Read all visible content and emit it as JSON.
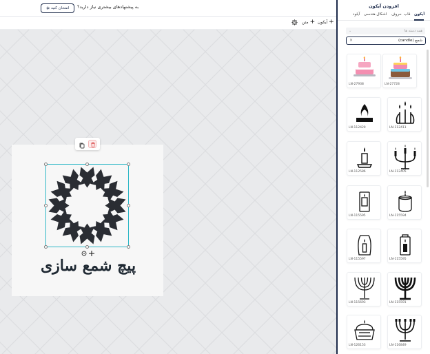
{
  "banner": {
    "message": "به پیشنهادهای بیشتری نیاز دارید؟",
    "try_button": "امتحان کنید"
  },
  "toolbar": {
    "add_icon": "آیکون",
    "add_text": "متن"
  },
  "canvas": {
    "caption": "پیچ شمع سازی"
  },
  "panel": {
    "title": "افزودن آیکون",
    "tabs": [
      "آیکون",
      "قاب",
      "حروف",
      "اشکال هندسی",
      "آیلود"
    ],
    "category_placeholder": "همه دسته ها",
    "search_value": "شمع (candle)"
  },
  "icons": [
    {
      "code": "LN-27728",
      "kind": "cake-color"
    },
    {
      "code": "LN-27938",
      "kind": "cake-pink"
    },
    {
      "code": "LN-112411",
      "kind": "candles-bunch"
    },
    {
      "code": "LN-112420",
      "kind": "flame-block"
    },
    {
      "code": "LN-112405",
      "kind": "candelabra"
    },
    {
      "code": "LN-112586",
      "kind": "candle-holder"
    },
    {
      "code": "LN-115594",
      "kind": "candle-jar-round"
    },
    {
      "code": "LN-115595",
      "kind": "candle-jar-tall"
    },
    {
      "code": "LN-115595",
      "kind": "lantern"
    },
    {
      "code": "LN-115597",
      "kind": "candle-vase"
    },
    {
      "code": "LN-115591",
      "kind": "menorah-bold"
    },
    {
      "code": "LN-115693",
      "kind": "menorah-thin"
    },
    {
      "code": "LN-116849",
      "kind": "menorah-small"
    },
    {
      "code": "LN-126153",
      "kind": "cupcake"
    }
  ]
}
